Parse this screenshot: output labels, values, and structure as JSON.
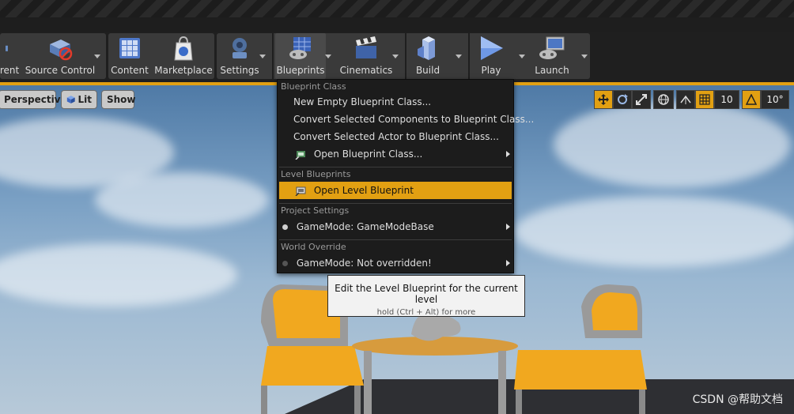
{
  "toolbar": {
    "buttons": [
      {
        "label": "rent",
        "icon": "current-level-icon"
      },
      {
        "label": "Source Control",
        "icon": "source-control-icon"
      },
      {
        "label": "Content",
        "icon": "content-icon"
      },
      {
        "label": "Marketplace",
        "icon": "marketplace-icon"
      },
      {
        "label": "Settings",
        "icon": "settings-icon"
      },
      {
        "label": "Blueprints",
        "icon": "blueprints-icon"
      },
      {
        "label": "Cinematics",
        "icon": "cinematics-icon"
      },
      {
        "label": "Build",
        "icon": "build-icon"
      },
      {
        "label": "Play",
        "icon": "play-icon"
      },
      {
        "label": "Launch",
        "icon": "launch-icon"
      }
    ]
  },
  "viewport": {
    "perspective": "Perspective",
    "lit": "Lit",
    "show": "Show",
    "grid_snap": "10",
    "rotation_snap": "10°"
  },
  "menu": {
    "sections": {
      "blueprint_class": "Blueprint Class",
      "level_blueprints": "Level Blueprints",
      "project_settings": "Project Settings",
      "world_override": "World Override"
    },
    "items": {
      "new_empty": "New Empty Blueprint Class...",
      "convert_components": "Convert Selected Components to Blueprint Class...",
      "convert_actor": "Convert Selected Actor to Blueprint Class...",
      "open_class": "Open Blueprint Class...",
      "open_level": "Open Level Blueprint",
      "gamemode_base": "GameMode: GameModeBase",
      "gamemode_override": "GameMode: Not overridden!"
    }
  },
  "tooltip": {
    "title": "Edit the Level Blueprint for the current level",
    "subtitle": "hold (Ctrl + Alt) for more"
  },
  "watermark": "CSDN @帮助文档",
  "colors": {
    "accent": "#e2a012",
    "menu_bg": "#1c1c1c",
    "toolbar_bg": "#3a3a3a"
  }
}
